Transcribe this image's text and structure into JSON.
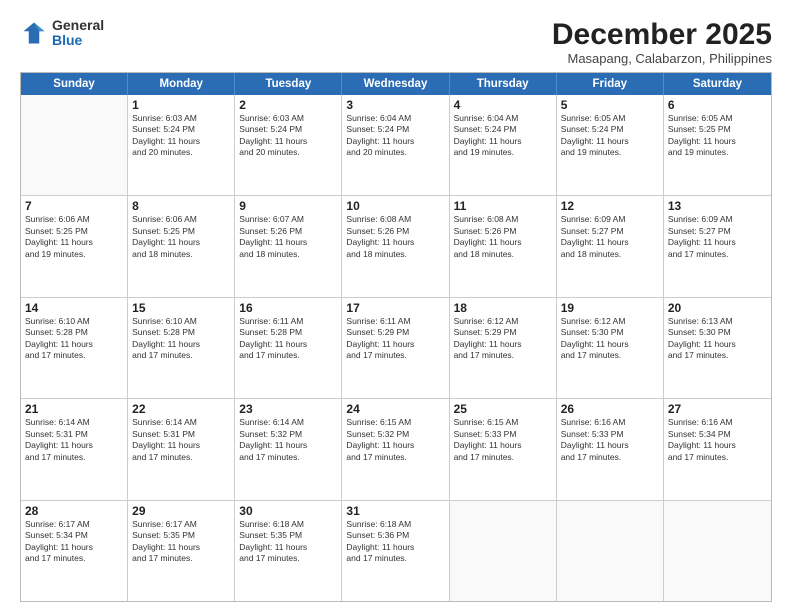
{
  "logo": {
    "general": "General",
    "blue": "Blue"
  },
  "title": "December 2025",
  "subtitle": "Masapang, Calabarzon, Philippines",
  "header_days": [
    "Sunday",
    "Monday",
    "Tuesday",
    "Wednesday",
    "Thursday",
    "Friday",
    "Saturday"
  ],
  "weeks": [
    [
      {
        "day": "",
        "info": ""
      },
      {
        "day": "1",
        "info": "Sunrise: 6:03 AM\nSunset: 5:24 PM\nDaylight: 11 hours\nand 20 minutes."
      },
      {
        "day": "2",
        "info": "Sunrise: 6:03 AM\nSunset: 5:24 PM\nDaylight: 11 hours\nand 20 minutes."
      },
      {
        "day": "3",
        "info": "Sunrise: 6:04 AM\nSunset: 5:24 PM\nDaylight: 11 hours\nand 20 minutes."
      },
      {
        "day": "4",
        "info": "Sunrise: 6:04 AM\nSunset: 5:24 PM\nDaylight: 11 hours\nand 19 minutes."
      },
      {
        "day": "5",
        "info": "Sunrise: 6:05 AM\nSunset: 5:24 PM\nDaylight: 11 hours\nand 19 minutes."
      },
      {
        "day": "6",
        "info": "Sunrise: 6:05 AM\nSunset: 5:25 PM\nDaylight: 11 hours\nand 19 minutes."
      }
    ],
    [
      {
        "day": "7",
        "info": "Sunrise: 6:06 AM\nSunset: 5:25 PM\nDaylight: 11 hours\nand 19 minutes."
      },
      {
        "day": "8",
        "info": "Sunrise: 6:06 AM\nSunset: 5:25 PM\nDaylight: 11 hours\nand 18 minutes."
      },
      {
        "day": "9",
        "info": "Sunrise: 6:07 AM\nSunset: 5:26 PM\nDaylight: 11 hours\nand 18 minutes."
      },
      {
        "day": "10",
        "info": "Sunrise: 6:08 AM\nSunset: 5:26 PM\nDaylight: 11 hours\nand 18 minutes."
      },
      {
        "day": "11",
        "info": "Sunrise: 6:08 AM\nSunset: 5:26 PM\nDaylight: 11 hours\nand 18 minutes."
      },
      {
        "day": "12",
        "info": "Sunrise: 6:09 AM\nSunset: 5:27 PM\nDaylight: 11 hours\nand 18 minutes."
      },
      {
        "day": "13",
        "info": "Sunrise: 6:09 AM\nSunset: 5:27 PM\nDaylight: 11 hours\nand 17 minutes."
      }
    ],
    [
      {
        "day": "14",
        "info": "Sunrise: 6:10 AM\nSunset: 5:28 PM\nDaylight: 11 hours\nand 17 minutes."
      },
      {
        "day": "15",
        "info": "Sunrise: 6:10 AM\nSunset: 5:28 PM\nDaylight: 11 hours\nand 17 minutes."
      },
      {
        "day": "16",
        "info": "Sunrise: 6:11 AM\nSunset: 5:28 PM\nDaylight: 11 hours\nand 17 minutes."
      },
      {
        "day": "17",
        "info": "Sunrise: 6:11 AM\nSunset: 5:29 PM\nDaylight: 11 hours\nand 17 minutes."
      },
      {
        "day": "18",
        "info": "Sunrise: 6:12 AM\nSunset: 5:29 PM\nDaylight: 11 hours\nand 17 minutes."
      },
      {
        "day": "19",
        "info": "Sunrise: 6:12 AM\nSunset: 5:30 PM\nDaylight: 11 hours\nand 17 minutes."
      },
      {
        "day": "20",
        "info": "Sunrise: 6:13 AM\nSunset: 5:30 PM\nDaylight: 11 hours\nand 17 minutes."
      }
    ],
    [
      {
        "day": "21",
        "info": "Sunrise: 6:14 AM\nSunset: 5:31 PM\nDaylight: 11 hours\nand 17 minutes."
      },
      {
        "day": "22",
        "info": "Sunrise: 6:14 AM\nSunset: 5:31 PM\nDaylight: 11 hours\nand 17 minutes."
      },
      {
        "day": "23",
        "info": "Sunrise: 6:14 AM\nSunset: 5:32 PM\nDaylight: 11 hours\nand 17 minutes."
      },
      {
        "day": "24",
        "info": "Sunrise: 6:15 AM\nSunset: 5:32 PM\nDaylight: 11 hours\nand 17 minutes."
      },
      {
        "day": "25",
        "info": "Sunrise: 6:15 AM\nSunset: 5:33 PM\nDaylight: 11 hours\nand 17 minutes."
      },
      {
        "day": "26",
        "info": "Sunrise: 6:16 AM\nSunset: 5:33 PM\nDaylight: 11 hours\nand 17 minutes."
      },
      {
        "day": "27",
        "info": "Sunrise: 6:16 AM\nSunset: 5:34 PM\nDaylight: 11 hours\nand 17 minutes."
      }
    ],
    [
      {
        "day": "28",
        "info": "Sunrise: 6:17 AM\nSunset: 5:34 PM\nDaylight: 11 hours\nand 17 minutes."
      },
      {
        "day": "29",
        "info": "Sunrise: 6:17 AM\nSunset: 5:35 PM\nDaylight: 11 hours\nand 17 minutes."
      },
      {
        "day": "30",
        "info": "Sunrise: 6:18 AM\nSunset: 5:35 PM\nDaylight: 11 hours\nand 17 minutes."
      },
      {
        "day": "31",
        "info": "Sunrise: 6:18 AM\nSunset: 5:36 PM\nDaylight: 11 hours\nand 17 minutes."
      },
      {
        "day": "",
        "info": ""
      },
      {
        "day": "",
        "info": ""
      },
      {
        "day": "",
        "info": ""
      }
    ]
  ]
}
